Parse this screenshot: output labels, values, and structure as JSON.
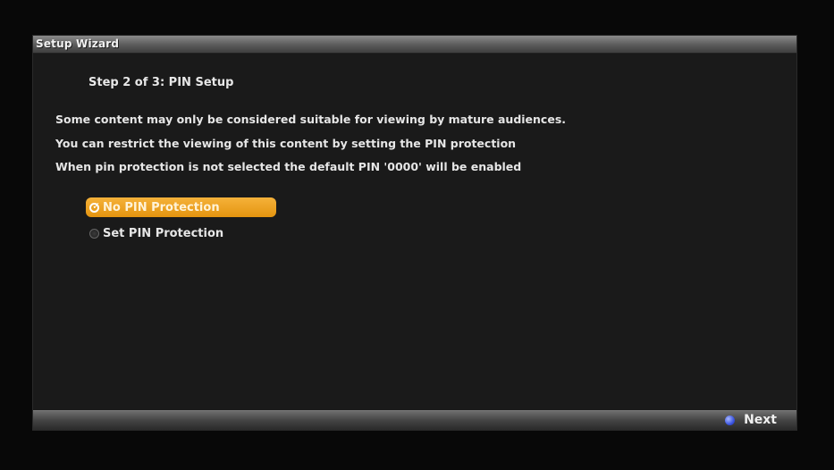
{
  "window": {
    "title": "Setup Wizard"
  },
  "step": {
    "label": "Step 2 of 3: PIN Setup"
  },
  "description": [
    "Some content may only be considered suitable for viewing by mature audiences.",
    "You can restrict the viewing of this content by setting the PIN protection",
    "When pin protection is not selected the default PIN '0000' will be enabled"
  ],
  "options": [
    {
      "label": "No PIN Protection",
      "selected": true
    },
    {
      "label": "Set PIN Protection",
      "selected": false
    }
  ],
  "footer": {
    "next_label": "Next",
    "next_button_color": "blue"
  },
  "colors": {
    "highlight": "#f0a526",
    "blue_button": "#3c55e0"
  }
}
